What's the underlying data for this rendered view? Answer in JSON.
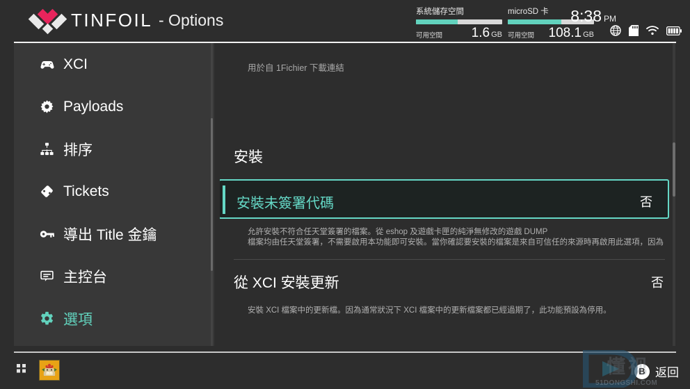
{
  "header": {
    "brand": "TINFOIL",
    "subtitle": "- Options",
    "logo_colors": {
      "pink": "#e8245c",
      "white": "#e9e9e9"
    },
    "system_storage": {
      "title": "系統儲存空間",
      "free_label": "可用空間",
      "value": "1.6",
      "unit": "GB",
      "fill_percent": 48
    },
    "microsd": {
      "title": "microSD 卡",
      "free_label": "可用空間",
      "value": "108.1",
      "unit": "GB",
      "fill_percent": 62
    },
    "clock": {
      "time": "8:38",
      "ampm": "PM"
    },
    "status_icons": [
      "globe-icon",
      "sdcard-icon",
      "wifi-icon",
      "battery-icon"
    ]
  },
  "sidebar": {
    "items": [
      {
        "label": "XCI",
        "icon": "gamepad-icon",
        "active": false
      },
      {
        "label": "Payloads",
        "icon": "burst-icon",
        "active": false
      },
      {
        "label": "排序",
        "icon": "sitemap-icon",
        "active": false
      },
      {
        "label": "Tickets",
        "icon": "ticket-icon",
        "active": false
      },
      {
        "label": "導出 Title 金鑰",
        "icon": "key-icon",
        "active": false
      },
      {
        "label": "主控台",
        "icon": "console-icon",
        "active": false
      },
      {
        "label": "選項",
        "icon": "gear-icon",
        "active": true
      }
    ]
  },
  "main": {
    "top_description": "用於自 1Fichier 下載連結",
    "section_title": "安裝",
    "rows": [
      {
        "label": "安裝未簽署代碼",
        "value": "否",
        "selected": true,
        "description": "允許安裝不符合任天堂簽署的檔案。從 eshop 及遊戲卡匣的純淨無修改的遊戲 DUMP\n檔案均由任天堂簽署，不需要啟用本功能即可安裝。當你確認要安裝的檔案是來自可信任的來源時再啟用此選項，因為"
      },
      {
        "label": "從 XCI 安裝更新",
        "value": "否",
        "selected": false,
        "description": "安裝 XCI 檔案中的更新檔。因為通常狀況下 XCI 檔案中的更新檔案都已經過期了，此功能預設為停用。"
      }
    ]
  },
  "footer": {
    "apps_icon": "grid-apps-icon",
    "game_tile_icon": "bowser-game-icon",
    "back_button": {
      "glyph": "B",
      "label": "返回"
    }
  },
  "watermark": {
    "chinese": "懂视",
    "url": "51DONGSHI.COM"
  },
  "accent_color": "#62d2bd"
}
